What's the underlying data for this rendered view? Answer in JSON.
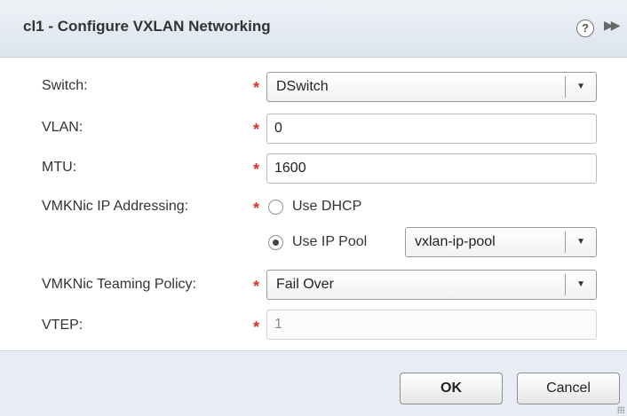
{
  "dialog": {
    "title": "cl1 - Configure VXLAN Networking",
    "help_glyph": "?",
    "expand_glyph": "▶▶"
  },
  "form": {
    "required_marker": "*",
    "switch": {
      "label": "Switch:",
      "value": "DSwitch"
    },
    "vlan": {
      "label": "VLAN:",
      "value": "0"
    },
    "mtu": {
      "label": "MTU:",
      "value": "1600"
    },
    "vmknic_ip": {
      "label": "VMKNic IP Addressing:",
      "options": [
        {
          "label": "Use DHCP",
          "checked": false
        },
        {
          "label": "Use IP Pool",
          "checked": true
        }
      ],
      "ip_pool_value": "vxlan-ip-pool"
    },
    "teaming": {
      "label": "VMKNic Teaming Policy:",
      "value": "Fail Over"
    },
    "vtep": {
      "label": "VTEP:",
      "value": "1",
      "disabled": true
    }
  },
  "footer": {
    "ok_label": "OK",
    "cancel_label": "Cancel"
  },
  "colors": {
    "required": "#d9342b",
    "titlebar": "#dde4ee",
    "footer": "#e8edf4"
  },
  "icons": {
    "help": "help-icon",
    "expand": "expand-icon",
    "dropdown": "chevron-down-icon"
  }
}
